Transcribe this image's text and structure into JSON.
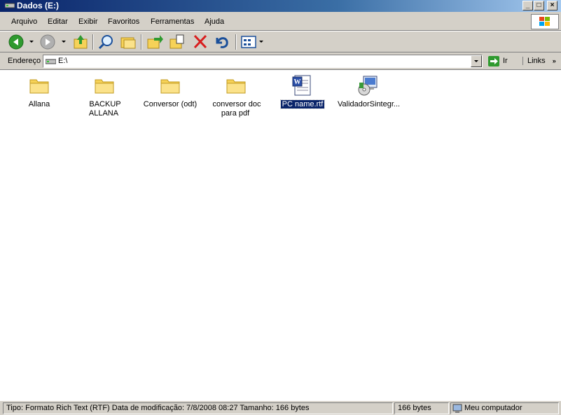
{
  "window": {
    "title": "Dados (E:)"
  },
  "menu": [
    "Arquivo",
    "Editar",
    "Exibir",
    "Favoritos",
    "Ferramentas",
    "Ajuda"
  ],
  "toolbar": {
    "buttons": [
      "back-icon",
      "forward-icon",
      "up-folder-icon",
      "search-icon",
      "folders-icon",
      "move-to-icon",
      "copy-to-icon",
      "delete-icon",
      "undo-icon",
      "views-icon"
    ]
  },
  "address": {
    "label": "Endereço",
    "value": "E:\\",
    "go_label": "Ir",
    "links_label": "Links"
  },
  "files": [
    {
      "name": "Allana",
      "type": "folder"
    },
    {
      "name": "BACKUP ALLANA",
      "type": "folder"
    },
    {
      "name": "Conversor (odt)",
      "type": "folder"
    },
    {
      "name": "conversor doc para pdf",
      "type": "folder"
    },
    {
      "name": "PC name.rtf",
      "type": "word-document",
      "selected": true
    },
    {
      "name": "ValidadorSintegr...",
      "type": "installer"
    }
  ],
  "status": {
    "details": "Tipo: Formato Rich Text (RTF) Data de modificação: 7/8/2008 08:27 Tamanho: 166 bytes",
    "size": "166 bytes",
    "zone": "Meu computador"
  },
  "colors": {
    "titlebar_start": "#0a246a",
    "titlebar_end": "#a6caf0",
    "chrome": "#d4d0c8",
    "selection": "#0a246a"
  }
}
